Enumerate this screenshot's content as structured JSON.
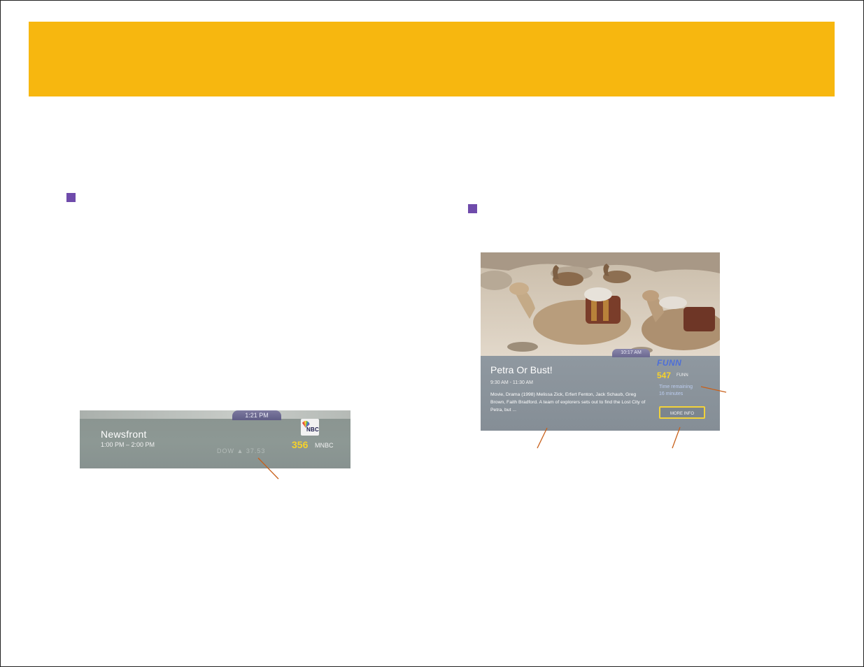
{
  "colors": {
    "header": "#f7b70f",
    "bullet": "#6f4bab",
    "channel_number": "#f6d22a",
    "network_logo": "#4e6fd8"
  },
  "left_banner": {
    "clock": "1:21 PM",
    "program_title": "Newsfront",
    "program_time": "1:00 PM – 2:00 PM",
    "faded_text": "DOW ▲ 37.53",
    "logo_text": "NBC",
    "channel_number": "356",
    "channel_name": "MNBC"
  },
  "right_banner": {
    "clock": "10:17 AM",
    "program_title": "Petra Or Bust!",
    "program_time": "9:30 AM - 11:30 AM",
    "description": "Movie, Drama (1998) Melissa Zick, Erfert Fenton, Jack Schaub, Greg Brown, Faith Bradford. A team of explorers sets out to find the Lost City of Petra, but ...",
    "network_logo": "FUNN",
    "channel_number": "547",
    "channel_name": "FUNN",
    "remaining_label": "Time remaining",
    "remaining_value": "16 minutes",
    "more_info_label": "MORE INFO"
  }
}
